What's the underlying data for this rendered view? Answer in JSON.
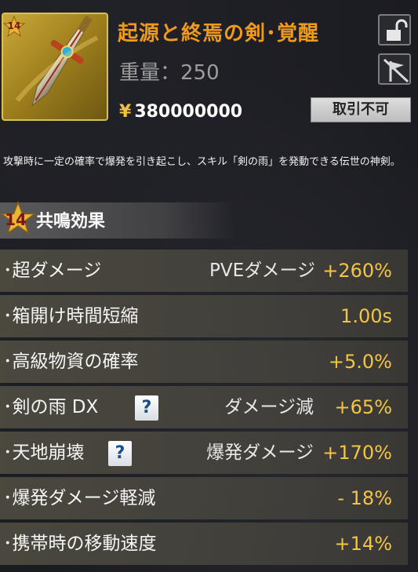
{
  "item": {
    "name": "起源と終焉の剣･覚醒",
    "weight_label": "重量：250",
    "price": "380000000",
    "price_icon": "yen-coin-icon",
    "rank": "14",
    "trade_status": "取引不可",
    "description": "攻撃時に一定の確率で爆発を引き起こし、スキル「剣の雨」を発動できる伝世の神剣。"
  },
  "resonance": {
    "rank": "14",
    "title": "共鳴効果"
  },
  "effects": [
    {
      "name": "･超ダメージ",
      "desc": "PVEダメージ",
      "value": "+260%",
      "help": false
    },
    {
      "name": "･箱開け時間短縮",
      "desc": "",
      "value": "1.00s",
      "help": false
    },
    {
      "name": "･高級物資の確率",
      "desc": "",
      "value": "+5.0%",
      "help": false
    },
    {
      "name": "･剣の雨 DX",
      "desc": "ダメージ減",
      "value": "+65%",
      "help": true
    },
    {
      "name": "･天地崩壊",
      "desc": "爆発ダメージ",
      "value": "+170%",
      "help": true
    },
    {
      "name": "･爆発ダメージ軽減",
      "desc": "",
      "value": "- 18%",
      "help": false
    },
    {
      "name": "･携帯時の移動速度",
      "desc": "",
      "value": "+14%",
      "help": false
    }
  ],
  "help_label": "?",
  "colors": {
    "name": "#f09a1c",
    "value": "#f4c443",
    "accent_gold": "#c9a83a"
  }
}
